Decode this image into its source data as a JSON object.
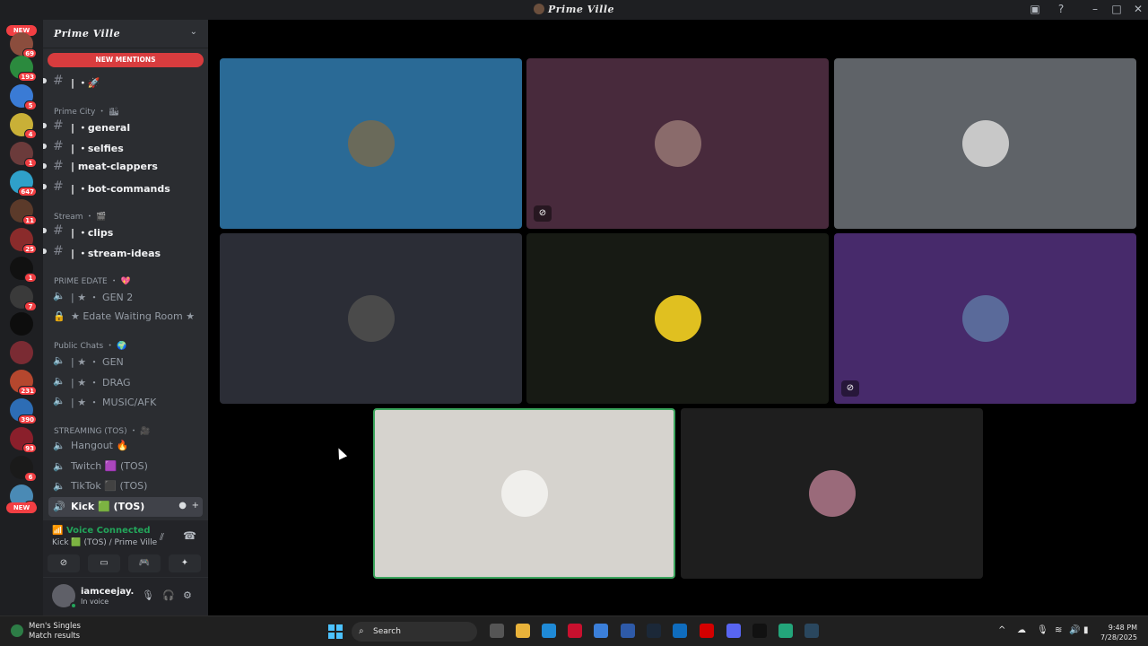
{
  "window": {
    "title": "Prime Ville",
    "controls": [
      "minimize",
      "maximize",
      "close"
    ]
  },
  "servers": {
    "new_label": "NEW",
    "items": [
      {
        "badge": "69",
        "color": "#8b4d3d"
      },
      {
        "badge": "193",
        "color": "#2b8a3e"
      },
      {
        "badge": "5",
        "color": "#3a7bd5"
      },
      {
        "badge": "4",
        "color": "#c9b037"
      },
      {
        "badge": "1",
        "color": "#6b3b3b"
      },
      {
        "badge": "647",
        "color": "#2fa0c9"
      },
      {
        "badge": "11",
        "color": "#5b3a2a"
      },
      {
        "badge": "25",
        "color": "#8a2b2b"
      },
      {
        "badge": "1",
        "color": "#111111"
      },
      {
        "badge": "7",
        "color": "#3a3a3a"
      },
      {
        "badge": "",
        "color": "#0d0d0d"
      },
      {
        "badge": "",
        "color": "#7a2b33"
      },
      {
        "badge": "231",
        "color": "#b5472e"
      },
      {
        "badge": "390",
        "color": "#2d6db5"
      },
      {
        "badge": "93",
        "color": "#8a1f2b"
      },
      {
        "badge": "6",
        "color": "#1a1a1a"
      },
      {
        "badge": "5",
        "color": "#4a8ab5"
      }
    ],
    "bottom_new": "NEW"
  },
  "sidebar": {
    "guild_name": "Prime Ville",
    "new_mentions": "NEW MENTIONS",
    "top_channel": "| ・🚀",
    "categories": {
      "prime_city": "Prime City ・ 🏙",
      "stream": "Stream ・ 🎬",
      "prime_edate": "PRIME EDATE ・ 💖",
      "public_chats": "Public Chats ・ 🌍",
      "streaming": "STREAMING (TOS) ・ 🎥"
    },
    "channels": {
      "general": "| ・general",
      "selfies": "| ・selfies",
      "meat_clappers": "| meat-clappers",
      "bot_commands": "| ・bot-commands",
      "clips": "| ・clips",
      "stream_ideas": "| ・stream-ideas",
      "gen2": "| ★ ・ GEN 2",
      "edate_waiting": "★ Edate Waiting Room ★",
      "gen": "| ★ ・ GEN",
      "drag": "| ★ ・ DRAG",
      "music_afk": "| ★ ・ MUSIC/AFK",
      "hangout": "Hangout 🔥",
      "twitch": "Twitch 🟪 (TOS)",
      "tiktok": "TikTok ⬛ (TOS)",
      "kick": "Kick 🟩 (TOS)"
    }
  },
  "voice": {
    "status": "Voice Connected",
    "location": "Kick 🟩 (TOS) / Prime Ville"
  },
  "user": {
    "name": "iamceejay.",
    "status": "In voice"
  },
  "tiles": [
    {
      "bg": "#2a6a96",
      "pfp": "#6a6a5a",
      "muted": false,
      "speaking": false
    },
    {
      "bg": "#482a3c",
      "pfp": "#8a6b6b",
      "muted": true,
      "speaking": false
    },
    {
      "bg": "#5f6368",
      "pfp": "#c8c8c8",
      "muted": false,
      "speaking": false
    },
    {
      "bg": "#2b2d36",
      "pfp": "#4a4a4a",
      "muted": false,
      "speaking": false
    },
    {
      "bg": "#171a14",
      "pfp": "#e0c020",
      "muted": false,
      "speaking": false
    },
    {
      "bg": "#472a6b",
      "pfp": "#5a6a9a",
      "muted": true,
      "speaking": false
    },
    {
      "bg": "#d6d3ce",
      "pfp": "#f0efec",
      "muted": false,
      "speaking": true
    },
    {
      "bg": "#1e1e1e",
      "pfp": "#9a6a7a",
      "muted": false,
      "speaking": false
    }
  ],
  "taskbar": {
    "weather_title": "Men's Singles",
    "weather_sub": "Match results",
    "search": "Search",
    "time": "9:48 PM",
    "date": "7/28/2025",
    "apps": [
      {
        "name": "task-view",
        "color": "#555555"
      },
      {
        "name": "file-explorer",
        "color": "#e8b23a"
      },
      {
        "name": "edge",
        "color": "#1f8ad6"
      },
      {
        "name": "mcafee",
        "color": "#c8102e"
      },
      {
        "name": "app-a",
        "color": "#3b7fd9"
      },
      {
        "name": "app-l",
        "color": "#2e5aa8"
      },
      {
        "name": "steam",
        "color": "#1b2838"
      },
      {
        "name": "outlook",
        "color": "#0f6cbd"
      },
      {
        "name": "youtube",
        "color": "#d40000"
      },
      {
        "name": "discord",
        "color": "#5865f2"
      },
      {
        "name": "tiktok",
        "color": "#111111"
      },
      {
        "name": "app-green",
        "color": "#23a57a"
      },
      {
        "name": "steam-2",
        "color": "#2a475e"
      }
    ]
  }
}
